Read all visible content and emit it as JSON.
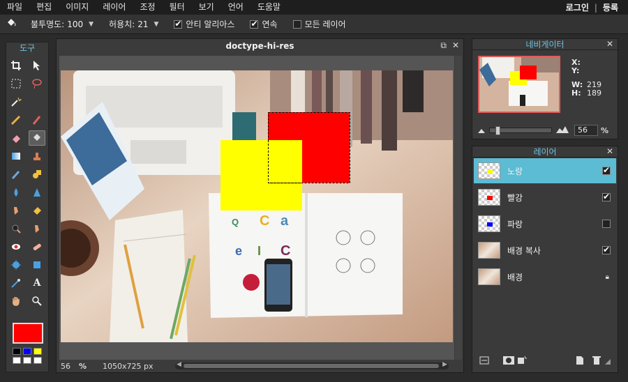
{
  "menu": {
    "items": [
      "파일",
      "편집",
      "이미지",
      "레이어",
      "조정",
      "필터",
      "보기",
      "언어",
      "도움말"
    ],
    "login": "로그인",
    "separator": "|",
    "register": "등록"
  },
  "options": {
    "opacity_label": "불투명도:",
    "opacity_value": "100",
    "tolerance_label": "허용치:",
    "tolerance_value": "21",
    "antialias_label": "안티 알리아스",
    "antialias_checked": true,
    "contiguous_label": "연속",
    "contiguous_checked": true,
    "all_layers_label": "모든 레이어",
    "all_layers_checked": false
  },
  "toolbox": {
    "title": "도구",
    "primary_color": "#ff0000",
    "swatches": [
      "#000000",
      "#0000ff",
      "#ffff00",
      "#ffffff",
      "#ffffff",
      "#ffffff"
    ]
  },
  "document": {
    "title": "doctype-hi-res",
    "zoom": "56",
    "zoom_unit": "%",
    "dimensions": "1050x725 px"
  },
  "navigator": {
    "title": "네비게이터",
    "x_label": "X:",
    "y_label": "Y:",
    "x_value": "",
    "y_value": "",
    "w_label": "W:",
    "h_label": "H:",
    "w_value": "219",
    "h_value": "189",
    "zoom_value": "56",
    "zoom_unit": "%"
  },
  "layers": {
    "title": "레이어",
    "items": [
      {
        "name": "노랑",
        "visible": true,
        "selected": true,
        "color": "#ffff00"
      },
      {
        "name": "빨강",
        "visible": true,
        "selected": false,
        "color": "#ff0000"
      },
      {
        "name": "파랑",
        "visible": false,
        "selected": false,
        "color": "#0000ff"
      },
      {
        "name": "배경 복사",
        "visible": true,
        "selected": false,
        "color": ""
      },
      {
        "name": "배경",
        "visible": true,
        "selected": false,
        "color": "",
        "locked": true
      }
    ]
  }
}
